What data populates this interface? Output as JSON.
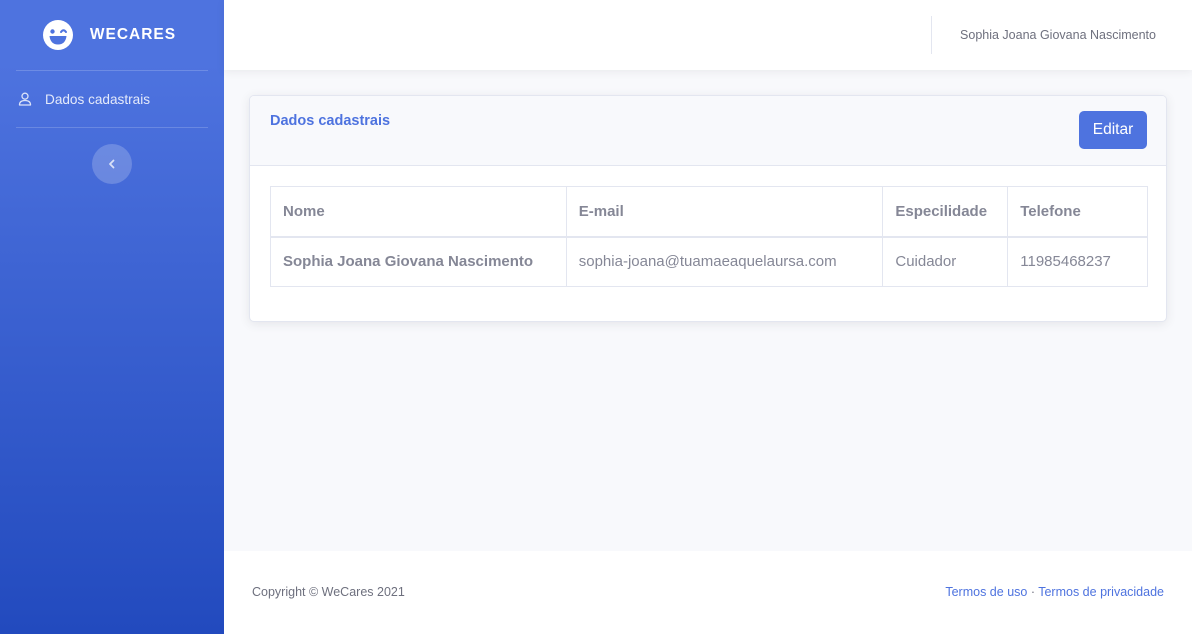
{
  "brand": {
    "name": "WECARES",
    "icon": "laugh-wink-icon"
  },
  "sidebar": {
    "items": [
      {
        "label": "Dados cadastrais",
        "icon": "user-icon"
      }
    ],
    "toggle_icon": "chevron-left-icon"
  },
  "topbar": {
    "user_name": "Sophia Joana Giovana Nascimento"
  },
  "card": {
    "title": "Dados cadastrais",
    "edit_label": "Editar",
    "table": {
      "headers": [
        "Nome",
        "E-mail",
        "Especilidade",
        "Telefone"
      ],
      "rows": [
        [
          "Sophia Joana Giovana Nascimento",
          "sophia-joana@tuamaeaquelaursa.com",
          "Cuidador",
          "11985468237"
        ]
      ]
    }
  },
  "footer": {
    "copyright": "Copyright © WeCares 2021",
    "link_terms": "Termos de uso",
    "separator": " · ",
    "link_privacy": "Termos de privacidade"
  },
  "colors": {
    "primary": "#4e73df",
    "primary_dark": "#224abe",
    "text": "#858796",
    "bg": "#f8f9fc"
  }
}
